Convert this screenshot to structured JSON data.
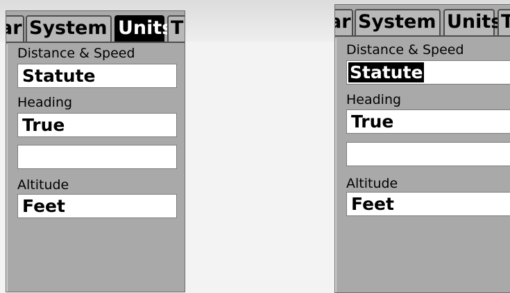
{
  "screens": [
    {
      "tabs": [
        {
          "label": "ar",
          "active": false
        },
        {
          "label": "System",
          "active": false
        },
        {
          "label": "Units",
          "active": true
        },
        {
          "label": "T",
          "active": false
        }
      ],
      "fields": [
        {
          "label": "Distance & Speed",
          "value": "Statute",
          "selected": false
        },
        {
          "label": "Heading",
          "value": "True",
          "selected": false
        },
        {
          "label": "",
          "value": "",
          "selected": false
        },
        {
          "label": "Altitude",
          "value": "Feet",
          "selected": false
        }
      ]
    },
    {
      "tabs": [
        {
          "label": "ar",
          "active": false
        },
        {
          "label": "System",
          "active": false
        },
        {
          "label": "Units",
          "active": false
        },
        {
          "label": "T",
          "active": false
        }
      ],
      "fields": [
        {
          "label": "Distance & Speed",
          "value": "Statute",
          "selected": true
        },
        {
          "label": "Heading",
          "value": "True",
          "selected": false
        },
        {
          "label": "",
          "value": "",
          "selected": false
        },
        {
          "label": "Altitude",
          "value": "Feet",
          "selected": false
        }
      ]
    }
  ]
}
